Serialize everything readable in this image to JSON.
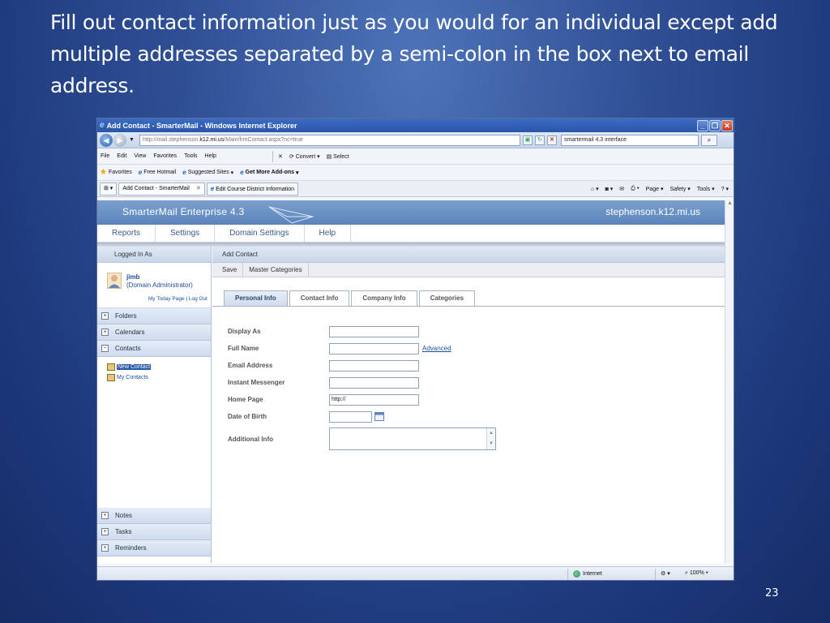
{
  "slide": {
    "title": "Fill out contact information just as you would for an individual except add multiple addresses separated by a semi-colon in the box next to email address.",
    "page_number": "23"
  },
  "browser": {
    "window_title": "Add Contact - SmarterMail - Windows Internet Explorer",
    "url_prefix": "http://mail.stephenson.",
    "url_domain": "k12.mi.us",
    "url_suffix": "/Main/frmContact.aspx?nc=true",
    "search_value": "smartermail 4.3 interface",
    "menu": [
      "File",
      "Edit",
      "View",
      "Favorites",
      "Tools",
      "Help"
    ],
    "toolbar_convert": "Convert",
    "toolbar_select": "Select",
    "favorites_label": "Favorites",
    "favorites_items": [
      "Free Hotmail",
      "Suggested Sites",
      "Get More Add-ons"
    ],
    "tabs": [
      "Add Contact - SmarterMail",
      "Edit Course District Information"
    ],
    "command_bar": [
      "Page",
      "Safety",
      "Tools"
    ],
    "status_zone": "Internet",
    "status_zoom": "100%"
  },
  "smartermail": {
    "brand": "SmarterMail Enterprise 4.3",
    "host": "stephenson.k12.mi.us",
    "nav": [
      "Reports",
      "Settings",
      "Domain Settings",
      "Help"
    ],
    "sidebar": {
      "header": "Logged In As",
      "username": "jimb",
      "role": "(Domain Administrator)",
      "links": "My Today Page | Log Out",
      "folders_top": [
        {
          "label": "Folders",
          "sign": "+"
        },
        {
          "label": "Calendars",
          "sign": "+"
        },
        {
          "label": "Contacts",
          "sign": "−"
        }
      ],
      "contact_items": [
        "New Contact",
        "My Contacts"
      ],
      "folders_bottom": [
        {
          "label": "Notes",
          "sign": "+"
        },
        {
          "label": "Tasks",
          "sign": "+"
        },
        {
          "label": "Reminders",
          "sign": "+"
        }
      ]
    },
    "main": {
      "header": "Add Contact",
      "toolbar": [
        "Save",
        "Master Categories"
      ],
      "tabs": [
        "Personal Info",
        "Contact Info",
        "Company Info",
        "Categories"
      ],
      "form": {
        "display_as": "Display As",
        "full_name": "Full Name",
        "advanced": "Advanced",
        "email": "Email Address",
        "im": "Instant Messenger",
        "home_page": "Home Page",
        "home_page_value": "http://",
        "dob": "Date of Birth",
        "additional": "Additional Info"
      }
    }
  }
}
